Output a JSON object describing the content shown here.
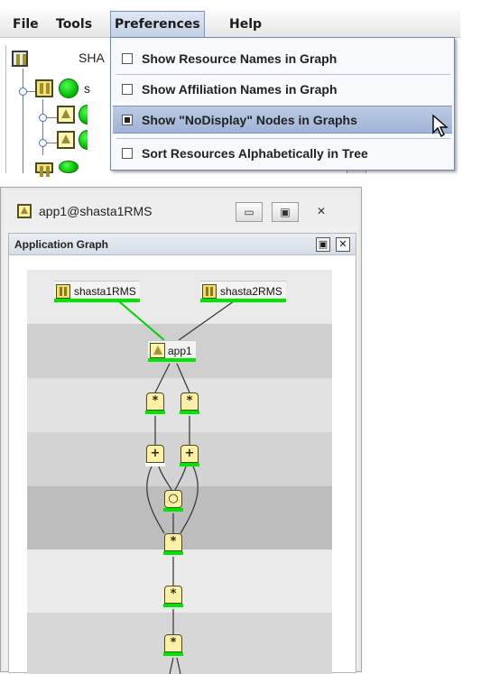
{
  "menubar": {
    "file": "File",
    "tools": "Tools",
    "preferences": "Preferences",
    "help": "Help"
  },
  "tree": {
    "root_label": "SHA",
    "row1_label": "s"
  },
  "preferences_menu": {
    "items": [
      {
        "label": "Show Resource Names in Graph",
        "checked": false
      },
      {
        "label": "Show Affiliation Names in Graph",
        "checked": false
      },
      {
        "label": "Show \"NoDisplay\" Nodes in Graphs",
        "checked": true,
        "highlighted": true
      },
      {
        "label": "Sort Resources Alphabetically in Tree",
        "checked": false
      }
    ]
  },
  "internal_frame": {
    "title": "app1@shasta1RMS",
    "minimize": "▭",
    "maximize": "▣",
    "close": "✕"
  },
  "graph_panel": {
    "title": "Application Graph",
    "restore_btn": "▣",
    "close_btn": "✕"
  },
  "graph": {
    "hosts": [
      "shasta1RMS",
      "shasta2RMS"
    ],
    "app": "app1",
    "resource_glyph": "*",
    "ip_glyph": "+",
    "gateway_glyph": "○"
  },
  "colors": {
    "online": "#00e600",
    "menu_highlight": "#9fb3d6",
    "node_fill": "#fff0a8"
  }
}
